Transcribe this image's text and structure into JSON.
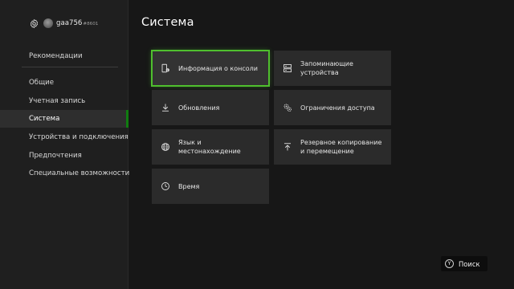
{
  "user": {
    "gamertag": "gaa756",
    "suffix": "#8601"
  },
  "sidebar": {
    "top_item": "Рекомендации",
    "items": [
      {
        "label": "Общие"
      },
      {
        "label": "Учетная запись"
      },
      {
        "label": "Система",
        "selected": true
      },
      {
        "label": "Устройства и подключения"
      },
      {
        "label": "Предпочтения"
      },
      {
        "label": "Специальные возможности"
      }
    ]
  },
  "main": {
    "title": "Система",
    "tiles": [
      {
        "label": "Информация о консоли",
        "icon": "console-info-icon",
        "focused": true
      },
      {
        "label": "Запоминающие устройства",
        "icon": "storage-icon"
      },
      {
        "label": "Обновления",
        "icon": "download-icon"
      },
      {
        "label": "Ограничения доступа",
        "icon": "gears-icon"
      },
      {
        "label": "Язык и местонахождение",
        "icon": "globe-icon"
      },
      {
        "label": "Резервное копирование и перемещение",
        "icon": "upload-icon"
      },
      {
        "label": "Время",
        "icon": "clock-icon"
      }
    ]
  },
  "footer": {
    "button_glyph": "Y",
    "search_label": "Поиск"
  },
  "colors": {
    "accent": "#107c10",
    "focus_outline": "#4fbf2e",
    "tile_bg": "#2b2b2b",
    "background": "#171717"
  }
}
